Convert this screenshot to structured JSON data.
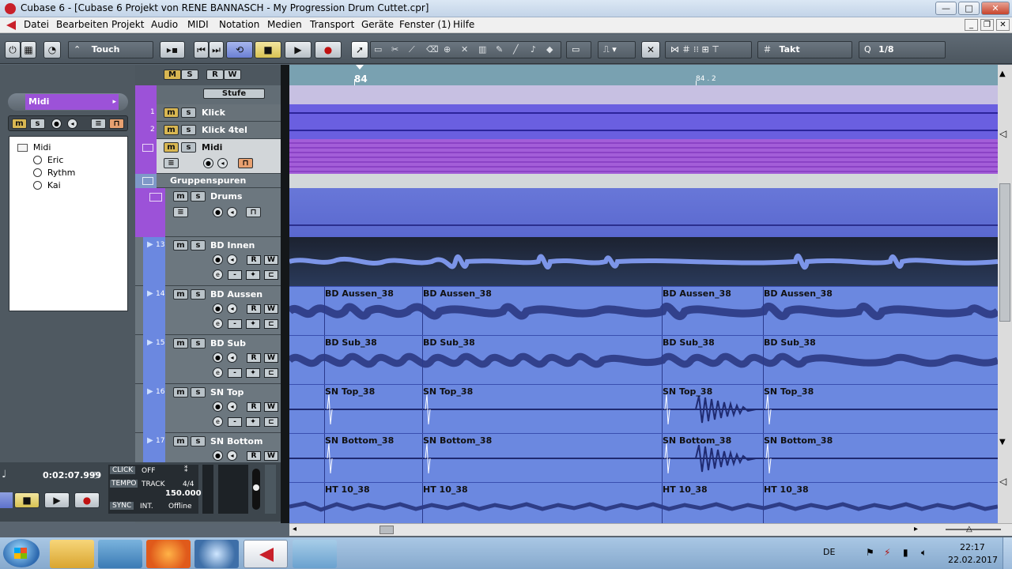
{
  "window": {
    "title": "Cubase 6 - [Cubase 6 Projekt von RENE BANNASCH - My Progression Drum Cuttet.cpr]",
    "minimize": "—",
    "maximize": "□",
    "close": "✕"
  },
  "menubar": {
    "items": [
      "Datei",
      "Bearbeiten",
      "Projekt",
      "Audio",
      "MIDI",
      "Notation",
      "Medien",
      "Transport",
      "Geräte",
      "Fenster (1)",
      "Hilfe"
    ]
  },
  "toolbar": {
    "automation_mode": "Touch",
    "grid_type": "Takt",
    "quantize": "1/8"
  },
  "inspector": {
    "channel_name": "Midi",
    "tree_root": "Midi",
    "tree_children": [
      "Eric",
      "Rythm",
      "Kai"
    ]
  },
  "tracklist": {
    "header_buttons": [
      "M",
      "S",
      "R",
      "W"
    ],
    "stufe": "Stufe",
    "tracks": [
      {
        "num": "1",
        "name": "Klick"
      },
      {
        "num": "2",
        "name": "Klick 4tel"
      },
      {
        "num": "",
        "name": "Midi"
      },
      {
        "num": "",
        "name": "Gruppenspuren"
      },
      {
        "num": "",
        "name": "Drums"
      },
      {
        "num": "13",
        "name": "BD Innen"
      },
      {
        "num": "14",
        "name": "BD Aussen"
      },
      {
        "num": "15",
        "name": "BD Sub"
      },
      {
        "num": "16",
        "name": "SN Top"
      },
      {
        "num": "17",
        "name": "SN Bottom"
      }
    ]
  },
  "ruler": {
    "marker1": "84",
    "marker2": "84 . 2"
  },
  "clips": {
    "bd_aussen": "BD Aussen_38",
    "bd_sub": "BD Sub_38",
    "sn_top": "SN Top_38",
    "sn_bottom": "SN Bottom_38",
    "ht": "HT 10_38"
  },
  "transport": {
    "time": "0:02:07.999",
    "click_label": "CLICK",
    "click_value": "OFF",
    "tempo_label": "TEMPO",
    "tempo_mode": "TRACK",
    "signature": "4/4",
    "tempo_value": "150.000",
    "sync_label": "SYNC",
    "sync_mode": "INT.",
    "sync_status": "Offline"
  },
  "taskbar": {
    "lang": "DE",
    "clock_time": "22:17",
    "clock_date": "22.02.2017"
  },
  "colors": {
    "track_blue": "#6b88e0",
    "midi_purple": "#9c52d8",
    "ruler": "#79a1b1",
    "mute": "#d9b752"
  }
}
